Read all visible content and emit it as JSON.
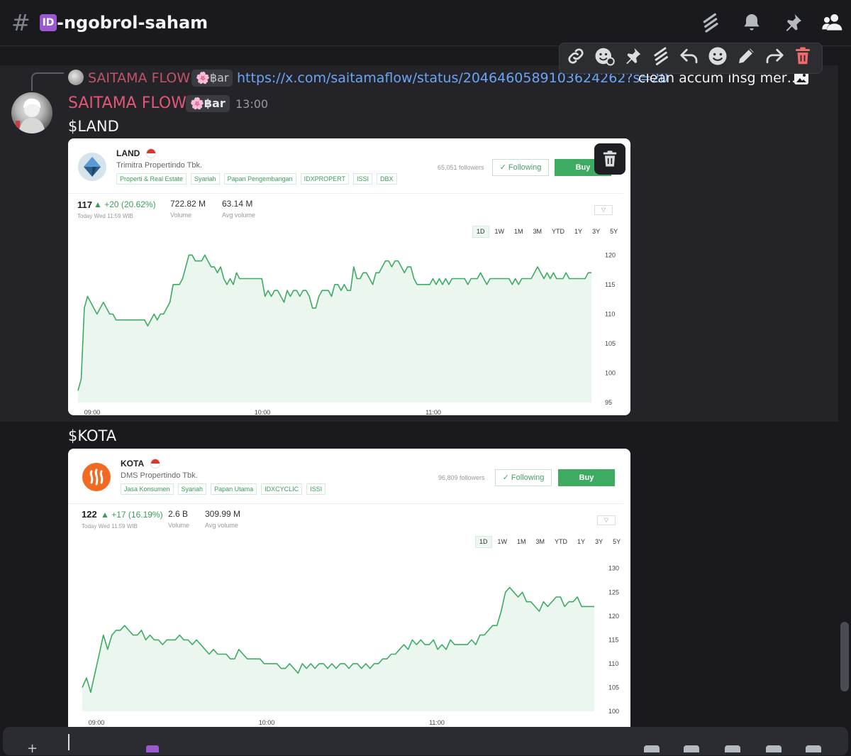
{
  "header": {
    "hash": "#",
    "channel_badge": "ID",
    "channel_name": "-ngobrol-saham"
  },
  "reply": {
    "author": "SAITAMA FLOW",
    "tag": "🌸฿аr",
    "link": "https://x.com/saitamaflow/status/2046460589103624262?s=20",
    "text": "clean accum ihsg mer…"
  },
  "message": {
    "author": "SAITAMA FLOW",
    "tag": "🌸฿аr",
    "timestamp": "13:00",
    "text1": "$LAND",
    "text2": "$KOTA"
  },
  "colors": {
    "author": "#e0577a",
    "link": "#6aa5f5",
    "positive": "#3a9c5a",
    "buy": "#3dab62"
  },
  "cards": [
    {
      "ticker": "LAND",
      "company": "Trimitra Propertindo Tbk.",
      "tags": [
        "Properti & Real Estate",
        "Syariah",
        "Papan Pengembangan",
        "IDXPROPERT",
        "ISSI",
        "DBX"
      ],
      "followers": "65,051 followers",
      "following_label": "Following",
      "buy_label": "Buy",
      "price": "117",
      "change": "+20 (20.62%)",
      "time_label": "Today Wed 11:59 WIB",
      "volume": "722.82 M",
      "volume_label": "Volume",
      "avg_volume": "63.14 M",
      "avg_volume_label": "Avg volume",
      "ranges": [
        "1D",
        "1W",
        "1M",
        "3M",
        "YTD",
        "1Y",
        "3Y",
        "5Y"
      ],
      "active_range": "1D"
    },
    {
      "ticker": "KOTA",
      "company": "DMS Propertindo Tbk.",
      "tags": [
        "Jasa Konsumen",
        "Syariah",
        "Papan Utama",
        "IDXCYCLIC",
        "ISSI"
      ],
      "followers": "96,809 followers",
      "following_label": "Following",
      "buy_label": "Buy",
      "price": "122",
      "change": "+17 (16.19%)",
      "time_label": "Today Wed 11:59 WIB",
      "volume": "2.6 B",
      "volume_label": "Volume",
      "avg_volume": "309.99 M",
      "avg_volume_label": "Avg volume",
      "ranges": [
        "1D",
        "1W",
        "1M",
        "3M",
        "YTD",
        "1Y",
        "3Y",
        "5Y"
      ],
      "active_range": "1D"
    }
  ],
  "chart_data": [
    {
      "type": "area",
      "x_ticks": [
        "09:00",
        "10:00",
        "11:00"
      ],
      "y_ticks": [
        95,
        100,
        105,
        110,
        115,
        120
      ],
      "ylim": [
        95,
        121
      ],
      "color": "#3dab62",
      "values": [
        97,
        99,
        111,
        113,
        112,
        111,
        110,
        111,
        112,
        111,
        110,
        110,
        109,
        109,
        109,
        109,
        109,
        109,
        109,
        109,
        109,
        109,
        108,
        109,
        110,
        109,
        110,
        110,
        111,
        112,
        115,
        115,
        115,
        116,
        118,
        120,
        120,
        119,
        119,
        119,
        120,
        119,
        118,
        118,
        117,
        118,
        116,
        115,
        116,
        115,
        117,
        116,
        116,
        116,
        116,
        116,
        116,
        116,
        116,
        113,
        114,
        113,
        114,
        114,
        113,
        112,
        114,
        113,
        114,
        114,
        113,
        114,
        114,
        113,
        111,
        111,
        113,
        114,
        114,
        114,
        113,
        115,
        115,
        114,
        115,
        114,
        114,
        118,
        116,
        116,
        117,
        117,
        116,
        115,
        117,
        117,
        118,
        119,
        119,
        118,
        119,
        119,
        118,
        117,
        118,
        118,
        116,
        115,
        115,
        115,
        115,
        115,
        116,
        115,
        116,
        115,
        116,
        115,
        116,
        116,
        116,
        116,
        116,
        115,
        116,
        116,
        116,
        117,
        116,
        115,
        116,
        116,
        116,
        116,
        116,
        116,
        116,
        115,
        116,
        115,
        116,
        116,
        116,
        116,
        117,
        118,
        117,
        116,
        117,
        116,
        117,
        116,
        116,
        116,
        117,
        116,
        116,
        116,
        116,
        116,
        116,
        117,
        117
      ]
    },
    {
      "type": "area",
      "x_ticks": [
        "09:00",
        "10:00",
        "11:00"
      ],
      "y_ticks": [
        100,
        105,
        110,
        115,
        120,
        125,
        130
      ],
      "ylim": [
        100,
        131
      ],
      "color": "#3dab62",
      "values": [
        105,
        107,
        104,
        108,
        112,
        116,
        113,
        116,
        117,
        117,
        118,
        117,
        116,
        116,
        117,
        115,
        116,
        115,
        115,
        114,
        115,
        115,
        115,
        116,
        115,
        115,
        114,
        115,
        114,
        113,
        112,
        113,
        112,
        112,
        112,
        111,
        111,
        113,
        112,
        111,
        111,
        111,
        111,
        110,
        110,
        110,
        110,
        109,
        109,
        110,
        109,
        108,
        110,
        109,
        110,
        109,
        110,
        110,
        109,
        110,
        109,
        110,
        110,
        109,
        110,
        110,
        109,
        110,
        109,
        110,
        110,
        111,
        111,
        112,
        112,
        113,
        114,
        113,
        115,
        114,
        115,
        114,
        114,
        115,
        113,
        114,
        113,
        115,
        114,
        114,
        114,
        114,
        115,
        114,
        116,
        116,
        117,
        118,
        118,
        121,
        125,
        126,
        125,
        124,
        125,
        123,
        123,
        122,
        121,
        123,
        122,
        123,
        124,
        124,
        122,
        123,
        123,
        124,
        122,
        122,
        122,
        122
      ]
    }
  ]
}
